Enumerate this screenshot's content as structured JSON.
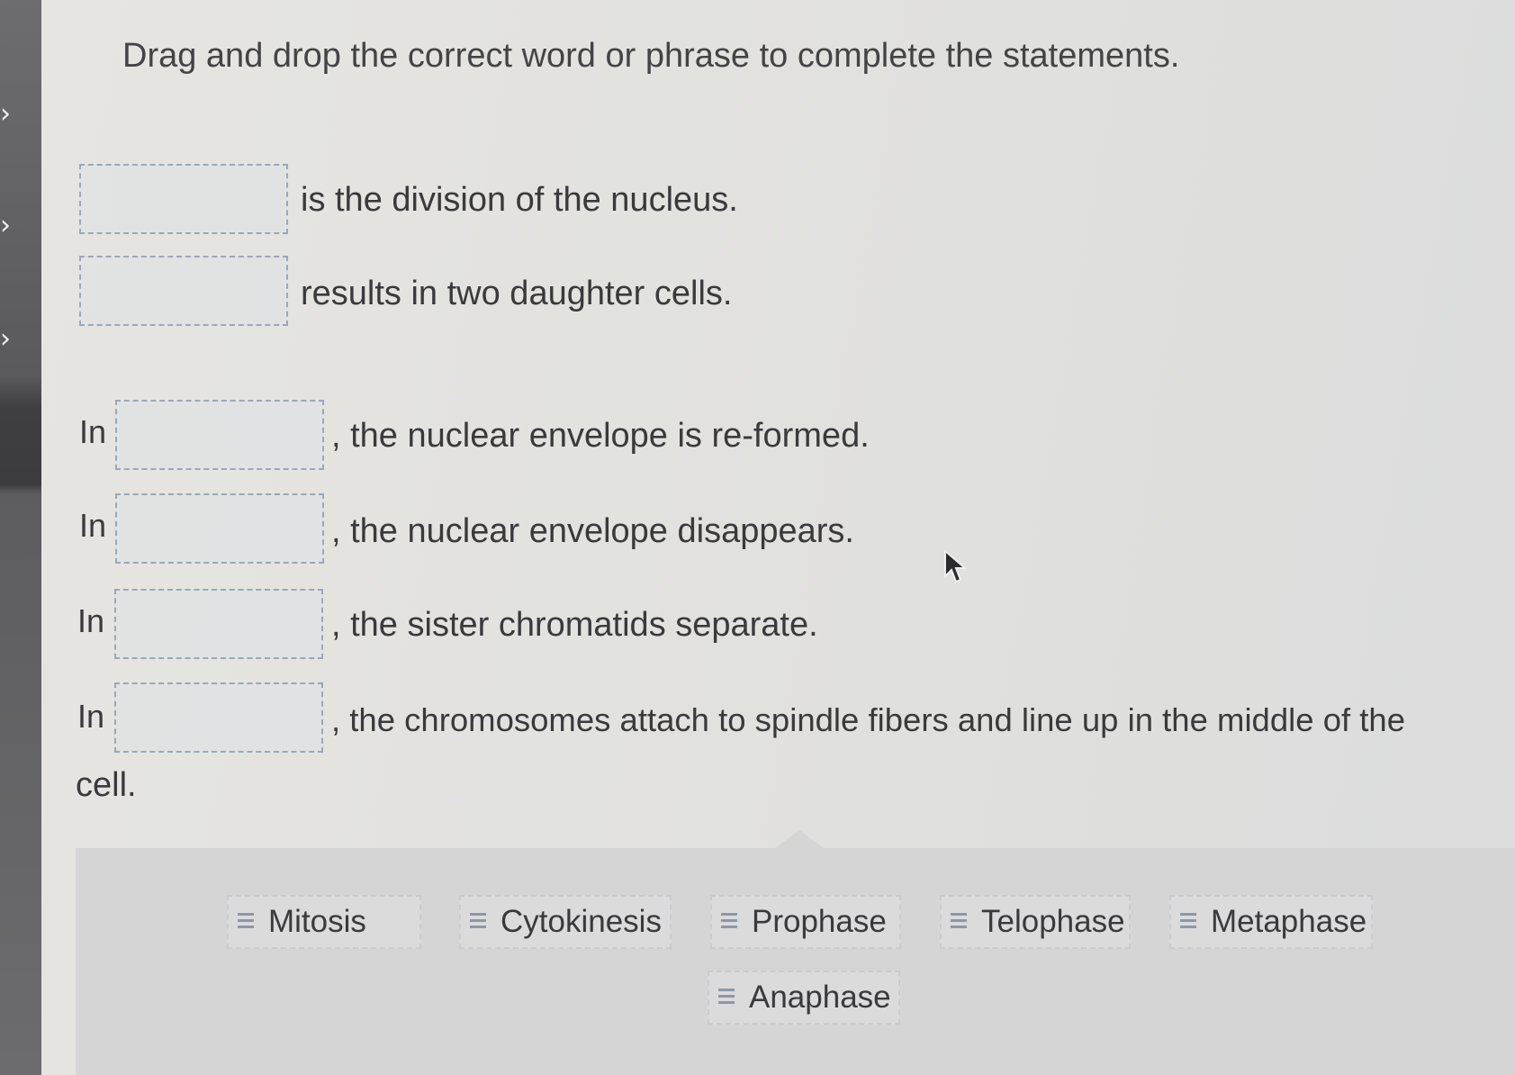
{
  "instruction": "Drag and drop the correct word or phrase to complete the statements.",
  "statements": [
    {
      "prefix": "",
      "suffix": "is the division of the nucleus."
    },
    {
      "prefix": "",
      "suffix": "results in two daughter cells."
    },
    {
      "prefix": "In",
      "suffix": ", the nuclear envelope is re-formed."
    },
    {
      "prefix": "In",
      "suffix": ", the nuclear envelope disappears."
    },
    {
      "prefix": "In",
      "suffix": ", the sister chromatids separate."
    },
    {
      "prefix": "In",
      "suffix": ", the chromosomes attach to spindle fibers and line up in the middle of the",
      "continuation": "cell."
    }
  ],
  "word_bank": [
    {
      "label": "Mitosis",
      "icon": "grip-lines-icon"
    },
    {
      "label": "Cytokinesis",
      "icon": "grip-lines-icon"
    },
    {
      "label": "Prophase",
      "icon": "grip-lines-icon"
    },
    {
      "label": "Telophase",
      "icon": "grip-lines-icon"
    },
    {
      "label": "Metaphase",
      "icon": "grip-lines-icon"
    },
    {
      "label": "Anaphase",
      "icon": "grip-lines-icon"
    }
  ],
  "colors": {
    "drop_border": "#9aa7bb",
    "bank_background": "#d5d5d6",
    "text": "#3a3a3c"
  }
}
